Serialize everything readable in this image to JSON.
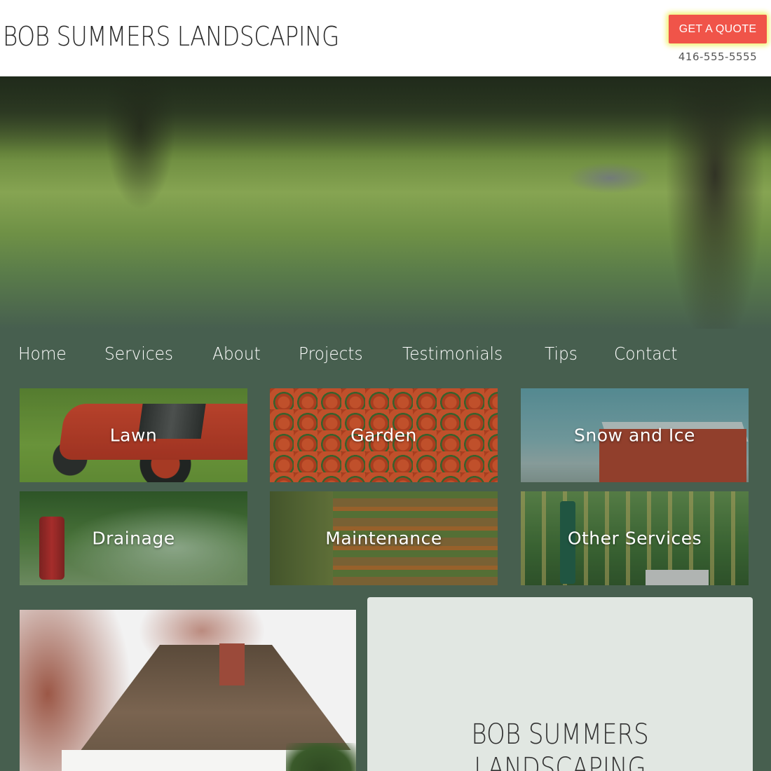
{
  "header": {
    "brand": "BOB SUMMERS LANDSCAPING",
    "quote_button": "GET A QUOTE",
    "phone": "416-555-5555"
  },
  "nav": {
    "items": [
      "Home",
      "Services",
      "About",
      "Projects",
      "Testimonials",
      "Tips",
      "Contact"
    ]
  },
  "services": {
    "tiles": [
      "Lawn",
      "Garden",
      "Snow and Ice",
      "Drainage",
      "Maintenance",
      "Other Services"
    ]
  },
  "about": {
    "title": "BOB SUMMERS LANDSCAPING"
  },
  "colors": {
    "background": "#475f4f",
    "accent": "#f05449",
    "card": "#e1e7e2"
  }
}
